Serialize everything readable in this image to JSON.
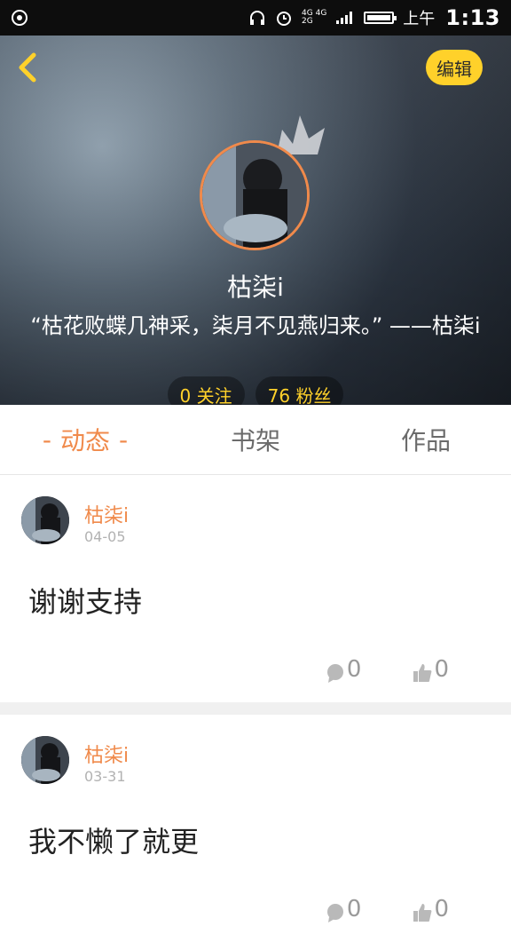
{
  "status_bar": {
    "net_top": "4G 4G",
    "net_bottom": "2G",
    "ampm": "上午",
    "time": "1:13"
  },
  "header": {
    "edit_label": "编辑",
    "name": "枯柒i",
    "bio": "“枯花败蝶几神采，柒月不见燕归来。” ——枯柒i",
    "following": "0 关注",
    "followers": "76 粉丝"
  },
  "tabs": [
    {
      "label": "动态",
      "active": true,
      "dash_left": "-",
      "dash_right": "-"
    },
    {
      "label": "书架",
      "active": false
    },
    {
      "label": "作品",
      "active": false
    }
  ],
  "posts": [
    {
      "username": "枯柒i",
      "date": "04-05",
      "content": "谢谢支持",
      "comments": "0",
      "likes": "0"
    },
    {
      "username": "枯柒i",
      "date": "03-31",
      "content": "我不懒了就更",
      "comments": "0",
      "likes": "0"
    }
  ],
  "colors": {
    "accent": "#f08a4b",
    "edit_bg": "#ffd12a",
    "stat_text": "#ffd12a"
  },
  "icons": {
    "back": "chevron-left-icon",
    "crown": "crown-icon",
    "comment": "comment-icon",
    "like": "thumbs-up-icon",
    "status_left": "app-icon",
    "headphones": "headphones-icon",
    "alarm": "alarm-icon",
    "signal": "signal-icon",
    "battery": "battery-icon"
  }
}
